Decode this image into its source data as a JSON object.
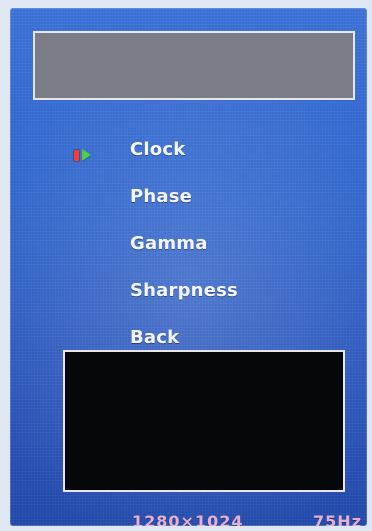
{
  "osd": {
    "menu": {
      "items": [
        {
          "label": "Clock",
          "selected": true
        },
        {
          "label": "Phase",
          "selected": false
        },
        {
          "label": "Gamma",
          "selected": false
        },
        {
          "label": "Sharpness",
          "selected": false
        },
        {
          "label": "Back",
          "selected": false
        }
      ]
    },
    "status": {
      "resolution": "1280×1024",
      "refresh": "75Hz"
    },
    "colors": {
      "background_top": "#3f74da",
      "background_bottom": "#244cae",
      "text": "#f3f6ff",
      "status_text": "#f2b4d2",
      "selector_red": "#ff3b2f",
      "selector_green": "#4fcf42",
      "frame": "#e9e5ef"
    },
    "icons": {
      "selector_marker": "red-block-icon",
      "selector_arrow": "green-arrow-icon"
    }
  }
}
